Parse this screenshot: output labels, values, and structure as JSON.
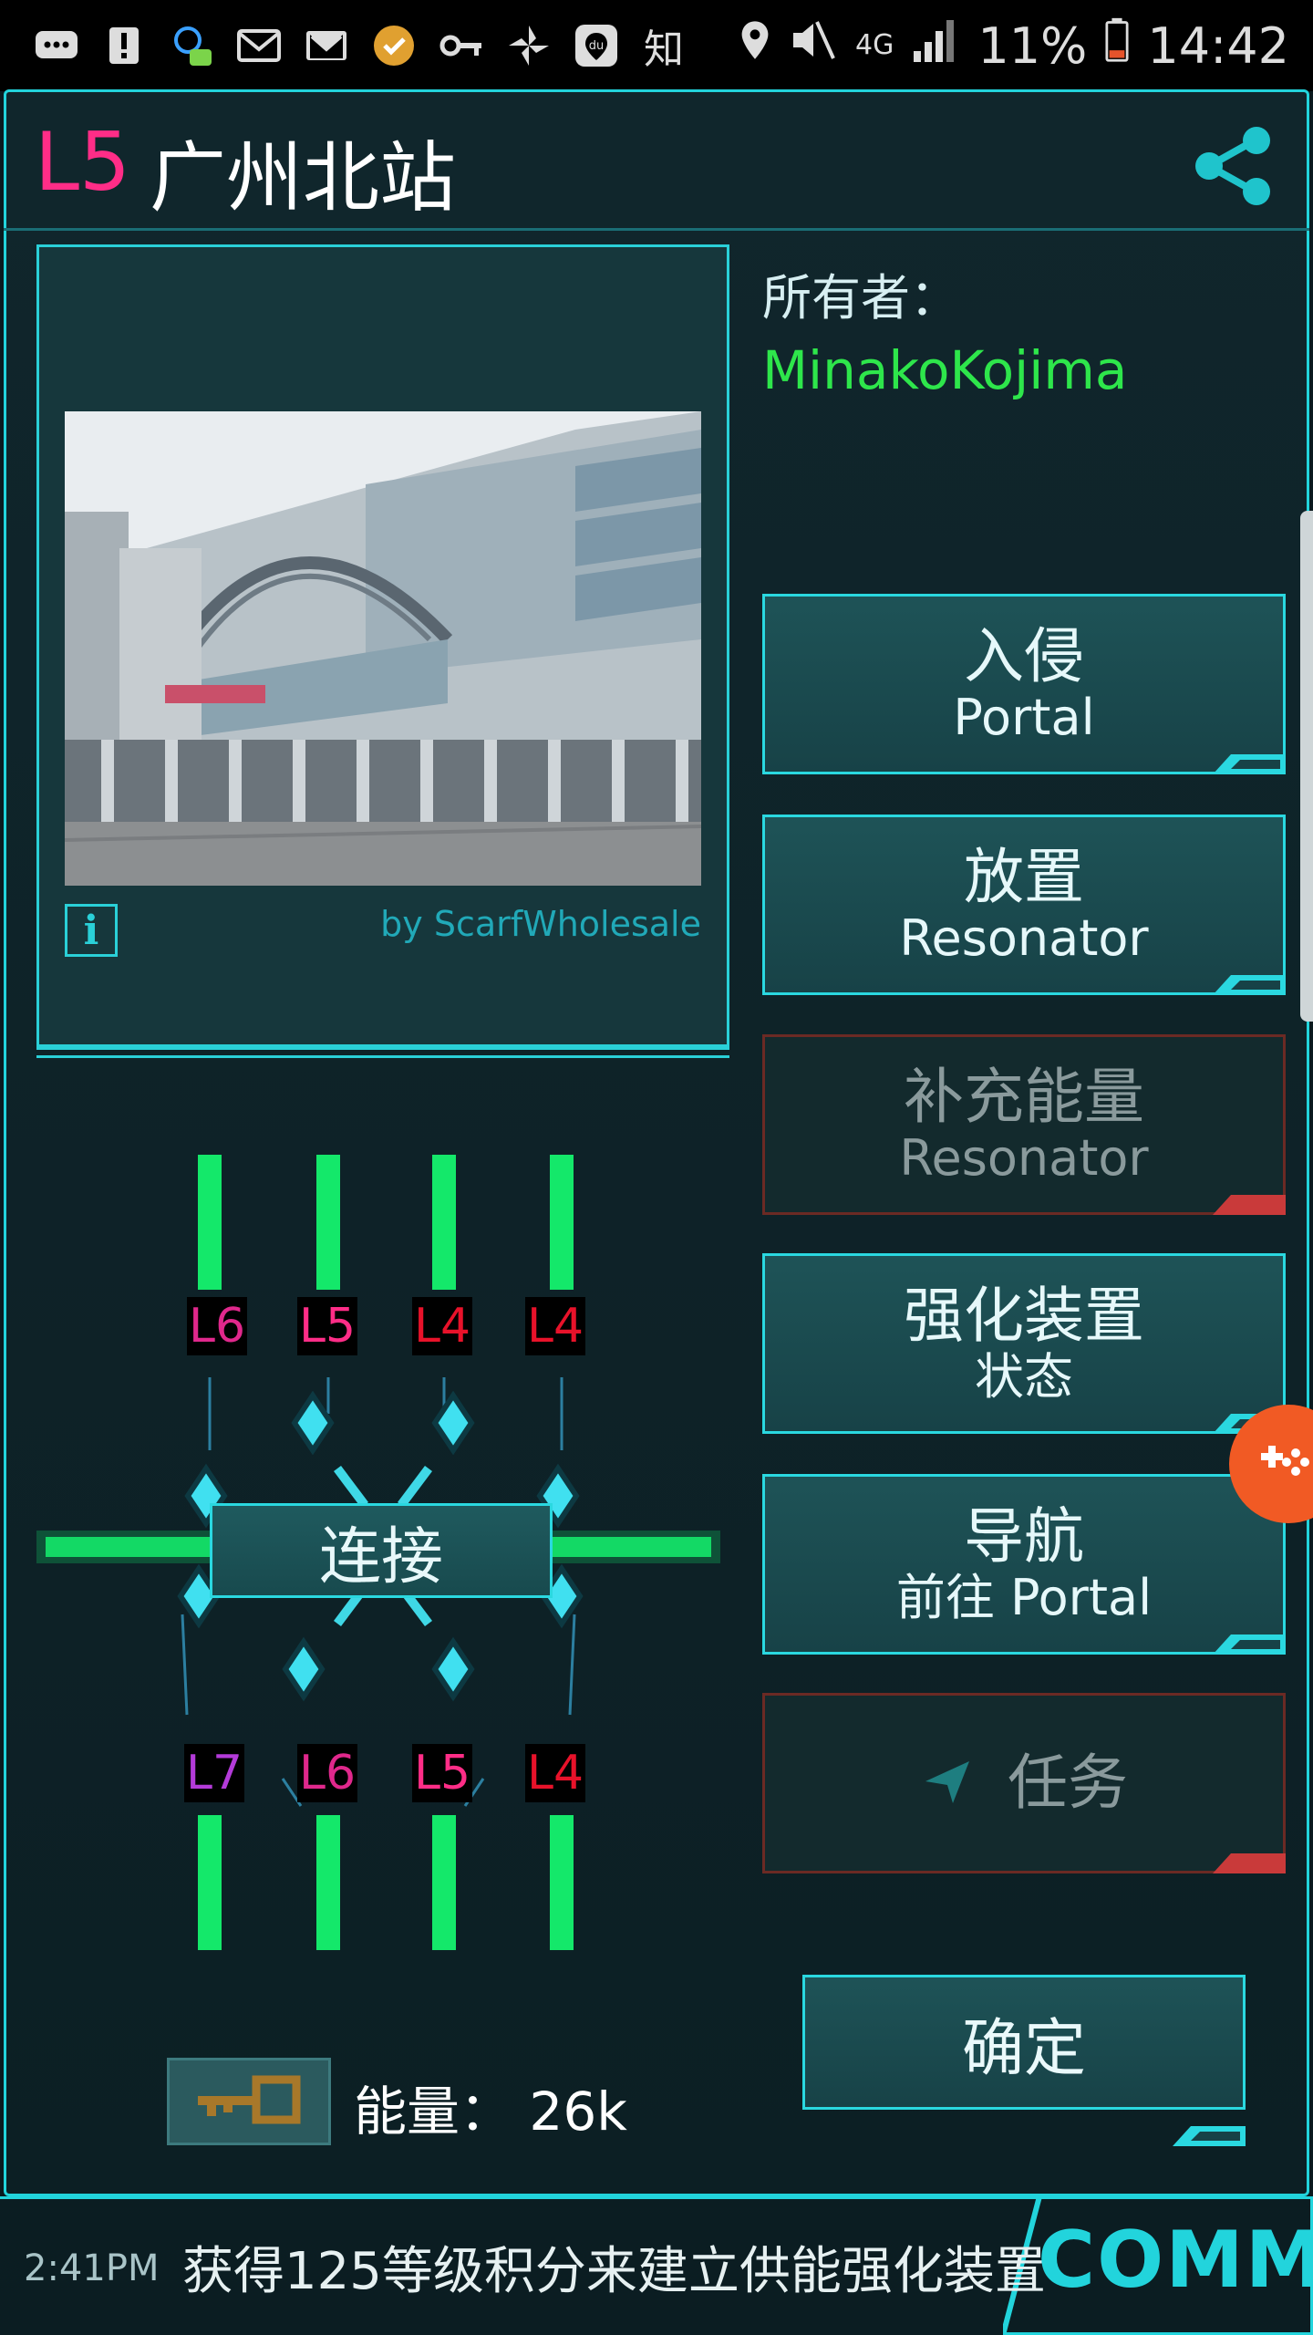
{
  "status_bar": {
    "icons": [
      "chat-bubble-icon",
      "alert-icon",
      "assistant-icon",
      "mail-icon",
      "gmail-icon",
      "badge-icon",
      "key-icon",
      "fan-icon",
      "du-icon",
      "zhihu-icon"
    ],
    "zhihu_text": "知",
    "du_text": "du",
    "network": "4G",
    "battery": "11%",
    "time": "14:42"
  },
  "portal": {
    "level": "L5",
    "name": "广州北站",
    "owner_label": "所有者：",
    "owner_name": "MinakoKojima",
    "photo_credit": "by ScarfWholesale",
    "info_label": "i"
  },
  "actions": [
    {
      "line1": "入侵",
      "line2": "Portal",
      "enabled": true
    },
    {
      "line1": "放置",
      "line2": "Resonator",
      "enabled": true
    },
    {
      "line1": "补充能量",
      "line2": "Resonator",
      "enabled": false
    },
    {
      "line1": "强化装置",
      "line2": "状态",
      "enabled": true
    },
    {
      "line1": "导航",
      "line2": "前往 Portal",
      "enabled": true
    },
    {
      "line1": "任务",
      "line2": "",
      "enabled": false
    }
  ],
  "confirm_label": "确定",
  "resonators": {
    "top": [
      {
        "label": "L6",
        "color": "#e0288c"
      },
      {
        "label": "L5",
        "color": "#ff2d87"
      },
      {
        "label": "L4",
        "color": "#e8122a"
      },
      {
        "label": "L4",
        "color": "#e8122a"
      }
    ],
    "bottom": [
      {
        "label": "L7",
        "color": "#b43bd9"
      },
      {
        "label": "L6",
        "color": "#e0288c"
      },
      {
        "label": "L5",
        "color": "#ff2d87"
      },
      {
        "label": "L4",
        "color": "#e8122a"
      }
    ]
  },
  "link_label": "连接",
  "energy_label": "能量： 26k",
  "comm": {
    "time": "2:41PM",
    "message": "获得125等级积分来建立供能强化装置",
    "tab_label": "COMM"
  },
  "colors": {
    "accent": "#22d4dc",
    "enlightened_green": "#2ee64b",
    "level_pink": "#ff2d87",
    "disabled_border": "#6b2a24"
  }
}
